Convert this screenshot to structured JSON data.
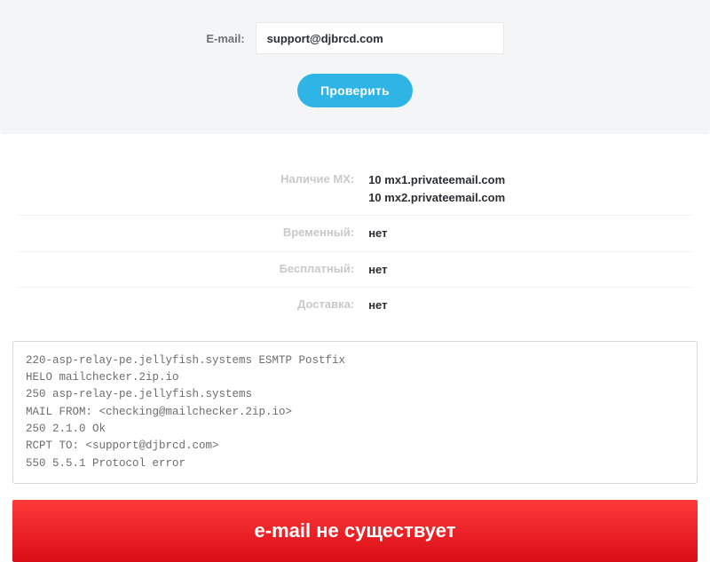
{
  "form": {
    "email_label": "E-mail:",
    "email_value": "support@djbrcd.com",
    "check_button": "Проверить"
  },
  "results": {
    "mx": {
      "label": "Наличие MX:",
      "records": [
        {
          "priority": "10",
          "host": "mx1.privateemail.com"
        },
        {
          "priority": "10",
          "host": "mx2.privateemail.com"
        }
      ]
    },
    "temporary": {
      "label": "Временный:",
      "value": "нет"
    },
    "free": {
      "label": "Бесплатный:",
      "value": "нет"
    },
    "delivery": {
      "label": "Доставка:",
      "value": "нет"
    }
  },
  "smtp_log": "220-asp-relay-pe.jellyfish.systems ESMTP Postfix\nHELO mailchecker.2ip.io\n250 asp-relay-pe.jellyfish.systems\nMAIL FROM: <checking@mailchecker.2ip.io>\n250 2.1.0 Ok\nRCPT TO: <support@djbrcd.com>\n550 5.5.1 Protocol error",
  "banner": {
    "text": "e-mail не существует"
  }
}
